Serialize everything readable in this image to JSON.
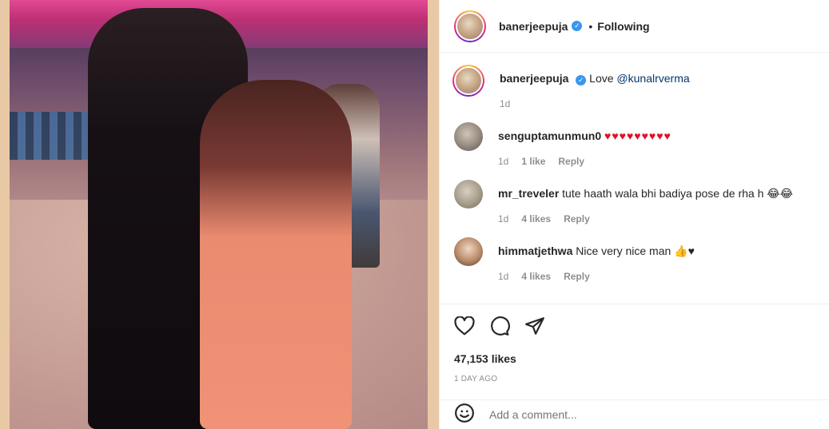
{
  "post": {
    "username": "banerjeepuja",
    "follow_status": "Following",
    "caption_text": "Love ",
    "caption_mention": "@kunalrverma",
    "caption_time": "1d",
    "likes": "47,153 likes",
    "posted_ago": "1 DAY AGO",
    "comment_placeholder": "Add a comment..."
  },
  "comments": [
    {
      "username": "senguptamunmun0",
      "text": "♥♥♥♥♥♥♥♥♥",
      "time": "1d",
      "likes": "1 like",
      "reply": "Reply"
    },
    {
      "username": "mr_treveler",
      "text": "tute haath wala bhi badiya pose de rha h 😂😂",
      "time": "1d",
      "likes": "4 likes",
      "reply": "Reply"
    },
    {
      "username": "himmatjethwa",
      "text": "Nice very nice man 👍♥",
      "time": "1d",
      "likes": "4 likes",
      "reply": "Reply"
    }
  ],
  "icons": {
    "verified": "verified-badge-icon",
    "like": "heart-outline-icon",
    "comment": "speech-bubble-icon",
    "share": "paper-plane-icon",
    "emoji": "smiley-icon"
  },
  "colors": {
    "verified": "#3897f0",
    "link": "#00376b",
    "heart": "#e0102a",
    "muted": "#8e8e8e"
  }
}
